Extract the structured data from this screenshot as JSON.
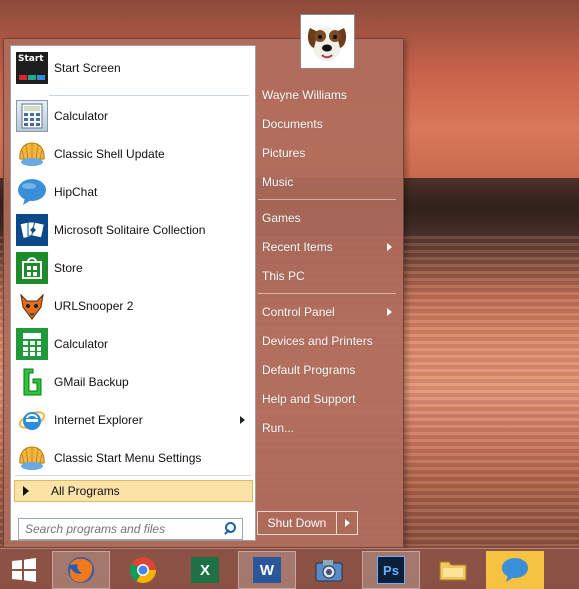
{
  "programs": [
    {
      "label": "Start Screen",
      "icon": "start-screen-icon"
    },
    {
      "label": "Calculator",
      "icon": "calculator-icon"
    },
    {
      "label": "Classic Shell Update",
      "icon": "shell-icon"
    },
    {
      "label": "HipChat",
      "icon": "hipchat-icon"
    },
    {
      "label": "Microsoft Solitaire Collection",
      "icon": "solitaire-icon"
    },
    {
      "label": "Store",
      "icon": "store-icon"
    },
    {
      "label": "URLSnooper 2",
      "icon": "fox-icon"
    },
    {
      "label": "Calculator",
      "icon": "calculator-green-icon"
    },
    {
      "label": "GMail Backup",
      "icon": "gmail-backup-icon"
    },
    {
      "label": "Internet Explorer",
      "icon": "ie-icon"
    },
    {
      "label": "Classic Start Menu Settings",
      "icon": "shell-icon"
    }
  ],
  "start_screen_tile_text": "Start",
  "all_programs": "All Programs",
  "search": {
    "placeholder": "Search programs and files"
  },
  "right": {
    "user": "Wayne Williams",
    "documents": "Documents",
    "pictures": "Pictures",
    "music": "Music",
    "games": "Games",
    "recent": "Recent Items",
    "thispc": "This PC",
    "control": "Control Panel",
    "devices": "Devices and Printers",
    "defaults": "Default Programs",
    "help": "Help and Support",
    "run": "Run..."
  },
  "shutdown": "Shut Down",
  "taskbar_text": {
    "excel": "X",
    "word": "W",
    "photoshop": "Ps"
  },
  "colors": {
    "accent": "#fbe3a8",
    "menu": "#b06c5c",
    "taskbar": "#8c5246"
  }
}
